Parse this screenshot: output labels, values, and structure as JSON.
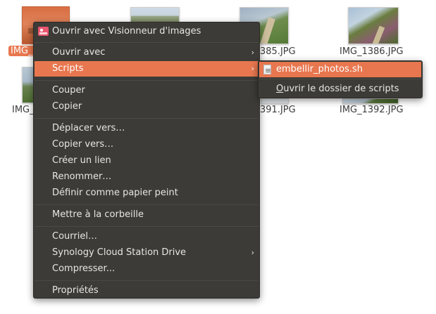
{
  "files": [
    {
      "name": "IMG_",
      "selected": true
    },
    {
      "name": "385.JPG",
      "selected": false
    },
    {
      "name": "IMG_1386.JPG",
      "selected": false
    },
    {
      "name": "IMG_",
      "selected": false
    },
    {
      "name": "391.JPG",
      "selected": false
    },
    {
      "name": "IMG_1392.JPG",
      "selected": false
    }
  ],
  "menu": {
    "open_with_viewer": "Ouvrir avec Visionneur d'images",
    "open_with": "Ouvrir avec",
    "scripts": "Scripts",
    "cut": "Couper",
    "copy": "Copier",
    "move_to": "Déplacer vers…",
    "copy_to": "Copier vers…",
    "create_link": "Créer un lien",
    "rename": "Renommer…",
    "set_wallpaper": "Définir comme papier peint",
    "trash": "Mettre à la corbeille",
    "email": "Courriel…",
    "synology": "Synology Cloud Station Drive",
    "compress": "Compresser...",
    "properties": "Propriétés",
    "submenu_arrow": "›"
  },
  "submenu": {
    "script_name": "embellir_photos.sh",
    "open_folder_first_letter": "O",
    "open_folder_rest": "uvrir le dossier de scripts"
  },
  "colors": {
    "menu_bg": "#3c3b37",
    "highlight": "#e8774f",
    "menu_text": "#e6e6e6"
  }
}
